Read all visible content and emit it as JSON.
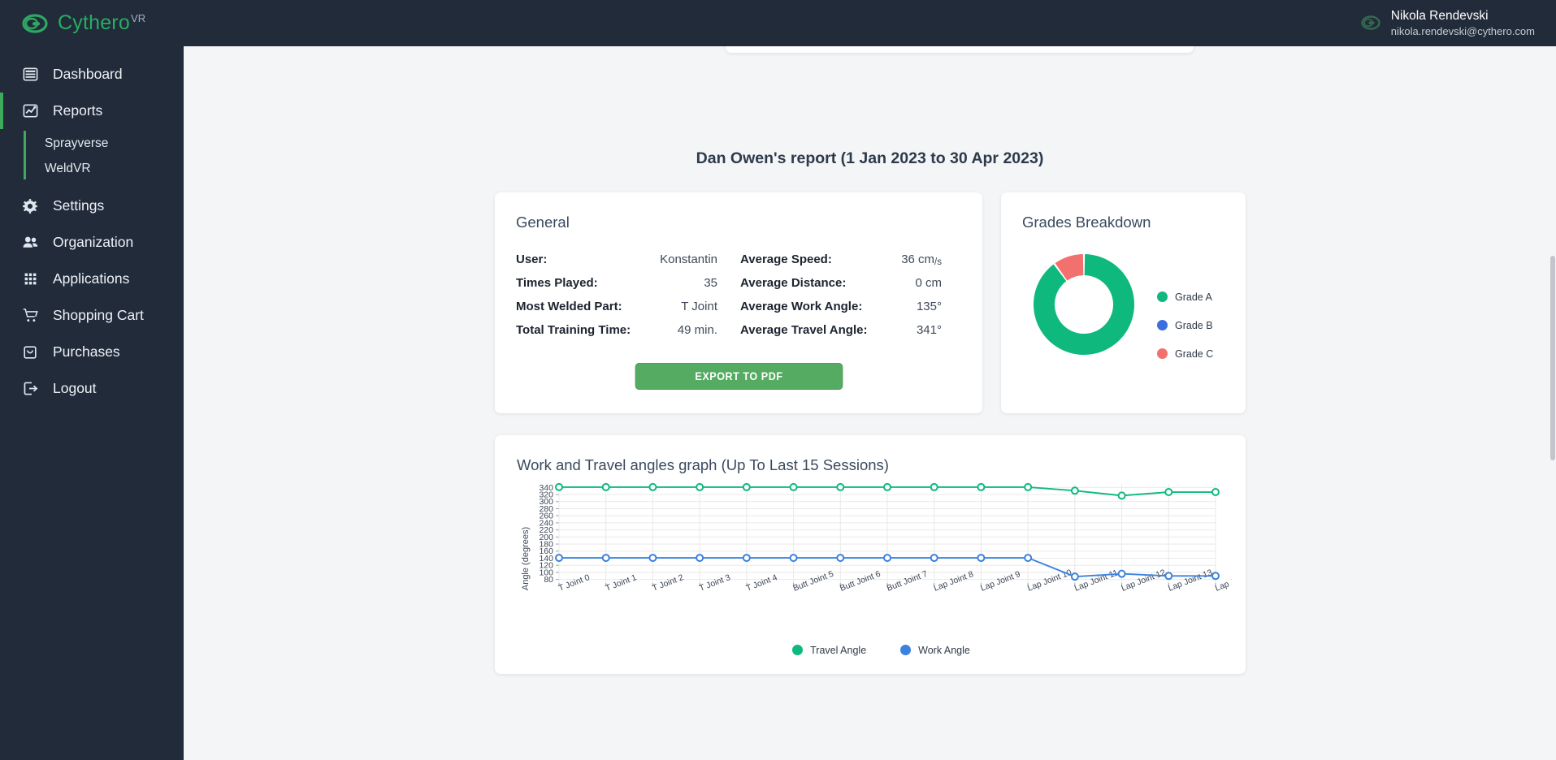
{
  "brand": {
    "name_part1": "Cythero",
    "name_sup": "VR",
    "logo_icon": "cythero-loop-logo"
  },
  "user": {
    "name": "Nikola Rendevski",
    "email": "nikola.rendevski@cythero.com",
    "avatar_icon": "cythero-loop-logo"
  },
  "sidebar": {
    "items": [
      {
        "label": "Dashboard",
        "icon": "dashboard-icon",
        "active": false
      },
      {
        "label": "Reports",
        "icon": "chart-report-icon",
        "active": true
      },
      {
        "label": "Settings",
        "icon": "gear-icon",
        "active": false
      },
      {
        "label": "Organization",
        "icon": "users-icon",
        "active": false
      },
      {
        "label": "Applications",
        "icon": "grid-apps-icon",
        "active": false
      },
      {
        "label": "Shopping Cart",
        "icon": "cart-icon",
        "active": false
      },
      {
        "label": "Purchases",
        "icon": "box-icon",
        "active": false
      },
      {
        "label": "Logout",
        "icon": "logout-icon",
        "active": false
      }
    ],
    "subitems": [
      {
        "label": "Sprayverse"
      },
      {
        "label": "WeldVR"
      }
    ]
  },
  "report": {
    "title": "Dan Owen's report (1 Jan 2023 to 30 Apr 2023)"
  },
  "general": {
    "title": "General",
    "left": [
      {
        "key": "User:",
        "value": "Konstantin"
      },
      {
        "key": "Times Played:",
        "value": "35"
      },
      {
        "key": "Most Welded Part:",
        "value": "T Joint"
      },
      {
        "key": "Total Training Time:",
        "value": "49 min."
      }
    ],
    "right": [
      {
        "key": "Average Speed:",
        "value": "36 cm",
        "sub": "/s"
      },
      {
        "key": "Average Distance:",
        "value": "0 cm",
        "sub": ""
      },
      {
        "key": "Average Work Angle:",
        "value": "135°",
        "sub": ""
      },
      {
        "key": "Average Travel Angle:",
        "value": "341°",
        "sub": ""
      }
    ],
    "export_label": "EXPORT TO PDF"
  },
  "grades": {
    "title": "Grades Breakdown"
  },
  "chart_section": {
    "title": "Work and Travel angles graph (Up To Last 15 Sessions)"
  },
  "colors": {
    "green": "#0fb97e",
    "blue": "#3b82e0",
    "red": "#f2706e",
    "sidebar_bg": "#222b3a",
    "page_bg": "#f4f5f7",
    "button_green": "#55ab61",
    "accent_green": "#3faa5a"
  },
  "chart_data": [
    {
      "type": "pie",
      "title": "Grades Breakdown",
      "labels": [
        "Grade A",
        "Grade B",
        "Grade C"
      ],
      "values": [
        90,
        0,
        10
      ],
      "colors": [
        "#0fb97e",
        "#3b6fe0",
        "#f2706e"
      ],
      "donut": true,
      "legend_position": "right"
    },
    {
      "type": "line",
      "title": "Work and Travel angles graph (Up To Last 15 Sessions)",
      "xlabel": "",
      "ylabel": "Angle (degrees)",
      "ylim": [
        70,
        350
      ],
      "yticks": [
        80,
        100,
        120,
        140,
        160,
        180,
        200,
        220,
        240,
        260,
        280,
        300,
        320,
        340
      ],
      "grid": true,
      "legend_position": "bottom",
      "categories": [
        "T Joint 0",
        "T Joint 1",
        "T Joint 2",
        "T Joint 3",
        "T Joint 4",
        "Butt Joint 5",
        "Butt Joint 6",
        "Butt Joint 7",
        "Lap Joint 8",
        "Lap Joint 9",
        "Lap Joint 10",
        "Lap Joint 11",
        "Lap Joint 12",
        "Lap Joint 13",
        "Lap Jo"
      ],
      "series": [
        {
          "name": "Travel Angle",
          "color": "#0fb97e",
          "values": [
            341,
            341,
            341,
            341,
            341,
            341,
            341,
            341,
            341,
            341,
            341,
            331,
            317,
            327,
            327
          ]
        },
        {
          "name": "Work Angle",
          "color": "#3b82e0",
          "values": [
            141,
            141,
            141,
            141,
            141,
            141,
            141,
            141,
            141,
            141,
            141,
            88,
            96,
            90,
            90
          ]
        }
      ]
    }
  ]
}
